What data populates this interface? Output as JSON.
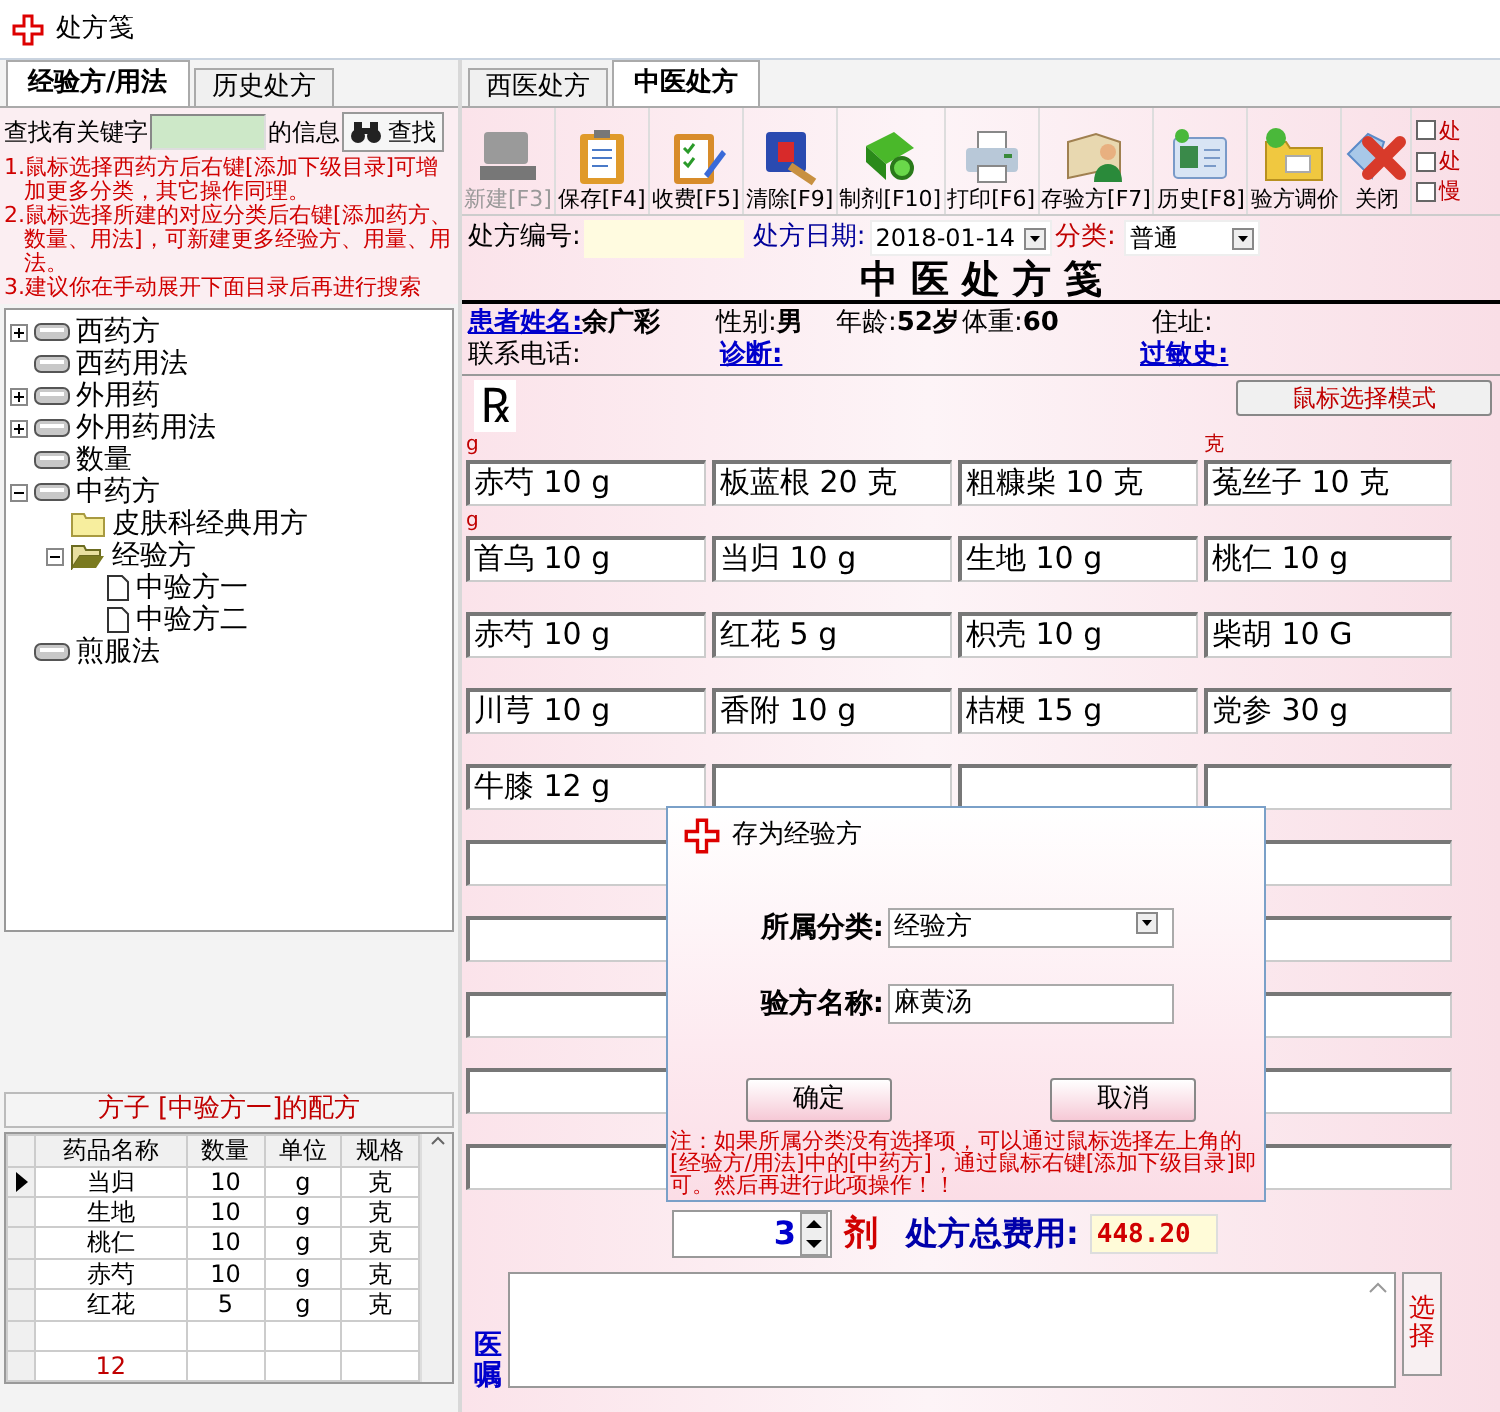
{
  "window": {
    "title": "处方笺"
  },
  "left": {
    "tabs": [
      {
        "label": "经验方/用法",
        "selected": true
      },
      {
        "label": "历史处方",
        "selected": false
      }
    ],
    "search": {
      "label_before": "查找有关键字",
      "label_after": "的信息",
      "button": "查找"
    },
    "notes": [
      "1.鼠标选择西药方后右键[添加下级目录]可增加更多分类，其它操作同理。",
      "2.鼠标选择所建的对应分类后右键[添加药方、数量、用法]，可新建更多经验方、用量、用法。",
      "3.建议你在手动展开下面目录后再进行搜索"
    ],
    "tree": [
      {
        "label": "西药方",
        "kind": "drawer",
        "expanded": false
      },
      {
        "label": "西药用法",
        "kind": "drawer"
      },
      {
        "label": "外用药",
        "kind": "drawer",
        "expanded": false
      },
      {
        "label": "外用药用法",
        "kind": "drawer",
        "expanded": false
      },
      {
        "label": "数量",
        "kind": "drawer"
      },
      {
        "label": "中药方",
        "kind": "drawer",
        "expanded": true,
        "children": [
          {
            "label": "皮肤科经典用方",
            "kind": "folder"
          },
          {
            "label": "经验方",
            "kind": "openfolder",
            "expanded": true,
            "children": [
              {
                "label": "中验方一",
                "kind": "document"
              },
              {
                "label": "中验方二",
                "kind": "document"
              }
            ]
          }
        ]
      },
      {
        "label": "煎服法",
        "kind": "drawer"
      }
    ],
    "recipe": {
      "title": "方子 [中验方一]的配方",
      "columns": [
        "药品名称",
        "数量",
        "单位",
        "规格"
      ],
      "rows": [
        {
          "cells": [
            "当归",
            "10",
            "g",
            "克"
          ],
          "selected": true
        },
        {
          "cells": [
            "生地",
            "10",
            "g",
            "克"
          ],
          "selected": false
        },
        {
          "cells": [
            "桃仁",
            "10",
            "g",
            "克"
          ],
          "selected": false
        },
        {
          "cells": [
            "赤芍",
            "10",
            "g",
            "克"
          ],
          "selected": false
        },
        {
          "cells": [
            "红花",
            "5",
            "g",
            "克"
          ],
          "selected": false
        }
      ],
      "footer": "12"
    }
  },
  "right": {
    "tabs": [
      {
        "label": "西医处方",
        "selected": false
      },
      {
        "label": "中医处方",
        "selected": true
      }
    ],
    "toolbar": [
      {
        "label": "新建[F3]",
        "disabled": true
      },
      {
        "label": "保存[F4]",
        "disabled": false
      },
      {
        "label": "收费[F5]",
        "disabled": false
      },
      {
        "label": "清除[F9]",
        "disabled": false
      },
      {
        "label": "制剂[F10]",
        "disabled": false
      },
      {
        "label": "打印[F6]",
        "disabled": false
      },
      {
        "label": "存验方[F7]",
        "disabled": false
      },
      {
        "label": "历史[F8]",
        "disabled": false
      },
      {
        "label": "验方调价",
        "disabled": false
      },
      {
        "label": "关闭",
        "disabled": false
      }
    ],
    "options": [
      {
        "label": "处",
        "checked": false
      },
      {
        "label": "处",
        "checked": false
      },
      {
        "label": "慢",
        "checked": false
      }
    ],
    "form": {
      "number_label": "处方编号:",
      "date_label": "处方日期:",
      "date": "2018-01-14",
      "category_label": "分类:",
      "category": "普通"
    },
    "heading": "中 医 处 方 笺",
    "patient": [
      [
        {
          "label": "患者姓名:",
          "value": "余广彩",
          "link": true
        },
        {
          "label": "性别:",
          "value": "男",
          "link": false
        },
        {
          "label": "年龄:",
          "value": "52岁",
          "link": false
        },
        {
          "label": "体重:",
          "value": "60",
          "link": false
        },
        {
          "label": "住址:",
          "link": false
        }
      ],
      [
        {
          "label": "联系电话:",
          "link": false
        },
        {
          "label": "诊断:",
          "link": true
        },
        {
          "label": "过敏史:",
          "link": true
        }
      ]
    ],
    "rx": "℞",
    "mode_button": "鼠标选择模式",
    "herbs": [
      {
        "text": "赤芍 10 g",
        "mark": "g"
      },
      {
        "text": "板蓝根 20 克"
      },
      {
        "text": "粗糠柴 10 克"
      },
      {
        "text": "菟丝子 10 克",
        "mark": "克"
      },
      {
        "text": "首乌 10 g",
        "mark": "g"
      },
      {
        "text": "当归 10 g"
      },
      {
        "text": "生地 10 g"
      },
      {
        "text": "桃仁 10 g"
      },
      {
        "text": "赤芍 10 g"
      },
      {
        "text": "红花 5 g"
      },
      {
        "text": "枳壳 10 g"
      },
      {
        "text": "柴胡 10 G"
      },
      {
        "text": "川芎 10 g"
      },
      {
        "text": "香附 10 g"
      },
      {
        "text": "桔梗 15 g"
      },
      {
        "text": "党参 30 g"
      },
      {
        "text": "牛膝 12 g"
      }
    ],
    "dose": {
      "value": "3",
      "unit": "剂",
      "total_label": "处方总费用:",
      "total": "448.20"
    },
    "advice": {
      "label": "医嘱",
      "button": "选择"
    }
  },
  "dialog": {
    "title": "存为经验方",
    "category_label": "所属分类:",
    "category": "经验方",
    "name_label": "验方名称:",
    "name": "麻黄汤",
    "buttons": [
      "确定",
      "取消"
    ],
    "note": "注：如果所属分类没有选择项，可以通过鼠标选择左上角的[经验方/用法]中的[中药方]，通过鼠标右键[添加下级目录]即可。然后再进行此项操作！！"
  }
}
